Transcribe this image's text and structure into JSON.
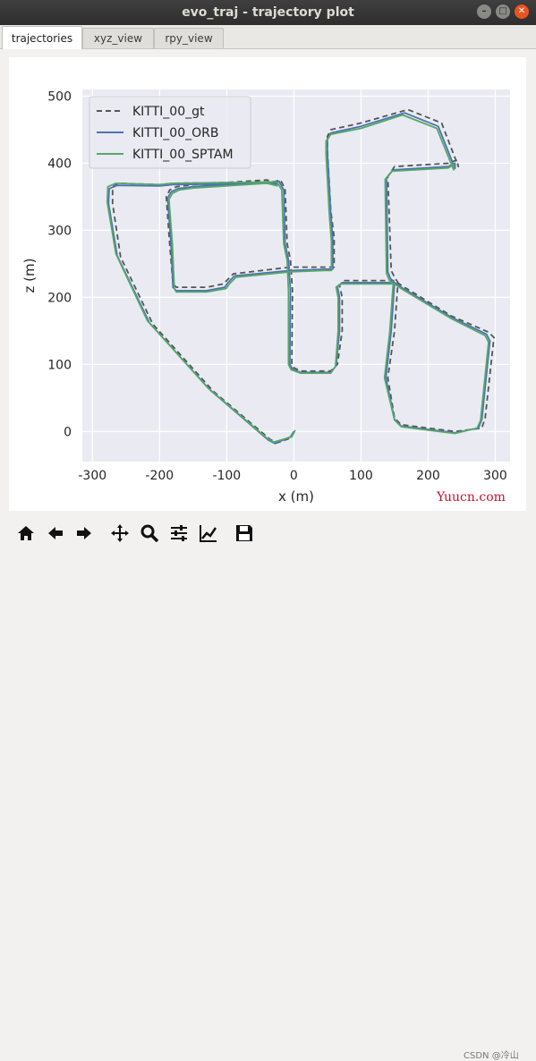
{
  "window": {
    "title": "evo_traj - trajectory plot",
    "buttons": [
      "minimize",
      "maximize",
      "close"
    ]
  },
  "tabs": [
    {
      "label": "trajectories",
      "active": true
    },
    {
      "label": "xyz_view",
      "active": false
    },
    {
      "label": "rpy_view",
      "active": false
    }
  ],
  "chart_data": {
    "type": "line",
    "xlabel": "x (m)",
    "ylabel": "z (m)",
    "xlim": [
      -315,
      322
    ],
    "ylim": [
      -45,
      510
    ],
    "xticks": [
      -300,
      -200,
      -100,
      0,
      100,
      200,
      300
    ],
    "yticks": [
      0,
      100,
      200,
      300,
      400,
      500
    ],
    "grid": true,
    "legend_position": "upper-left",
    "series": [
      {
        "name": "KITTI_00_gt",
        "color": "#555555",
        "dash": "dashed",
        "points": [
          [
            0,
            0
          ],
          [
            -5,
            -10
          ],
          [
            -25,
            -17
          ],
          [
            -35,
            -12
          ],
          [
            -120,
            60
          ],
          [
            -210,
            160
          ],
          [
            -258,
            260
          ],
          [
            -270,
            340
          ],
          [
            -270,
            365
          ],
          [
            -260,
            370
          ],
          [
            -200,
            368
          ],
          [
            -180,
            370
          ],
          [
            -30,
            372
          ],
          [
            -20,
            375
          ],
          [
            -13,
            362
          ],
          [
            -10,
            280
          ],
          [
            -5,
            255
          ],
          [
            -2,
            210
          ],
          [
            -3,
            100
          ],
          [
            0,
            95
          ],
          [
            10,
            90
          ],
          [
            55,
            90
          ],
          [
            65,
            100
          ],
          [
            72,
            150
          ],
          [
            72,
            200
          ],
          [
            68,
            218
          ],
          [
            72,
            222
          ],
          [
            75,
            225
          ],
          [
            150,
            225
          ],
          [
            160,
            218
          ],
          [
            235,
            172
          ],
          [
            290,
            148
          ],
          [
            298,
            140
          ],
          [
            285,
            20
          ],
          [
            280,
            5
          ],
          [
            240,
            0
          ],
          [
            200,
            5
          ],
          [
            160,
            10
          ],
          [
            150,
            20
          ],
          [
            140,
            80
          ],
          [
            150,
            150
          ],
          [
            155,
            222
          ],
          [
            150,
            230
          ],
          [
            145,
            240
          ],
          [
            140,
            380
          ],
          [
            150,
            395
          ],
          [
            230,
            400
          ],
          [
            243,
            405
          ],
          [
            245,
            395
          ],
          [
            220,
            460
          ],
          [
            170,
            480
          ],
          [
            100,
            460
          ],
          [
            55,
            450
          ],
          [
            50,
            440
          ],
          [
            50,
            420
          ],
          [
            55,
            330
          ],
          [
            60,
            290
          ],
          [
            60,
            245
          ],
          [
            50,
            245
          ],
          [
            -5,
            245
          ],
          [
            -90,
            235
          ],
          [
            -100,
            225
          ],
          [
            -105,
            220
          ],
          [
            -130,
            215
          ],
          [
            -175,
            215
          ],
          [
            -180,
            220
          ],
          [
            -185,
            280
          ],
          [
            -190,
            350
          ],
          [
            -185,
            360
          ],
          [
            -175,
            365
          ],
          [
            -150,
            368
          ],
          [
            -40,
            375
          ],
          [
            -20,
            370
          ]
        ]
      },
      {
        "name": "KITTI_00_ORB",
        "color": "#4c72b0",
        "dash": "solid",
        "points": [
          [
            0,
            0
          ],
          [
            -5,
            -8
          ],
          [
            -28,
            -18
          ],
          [
            -38,
            -13
          ],
          [
            -125,
            62
          ],
          [
            -215,
            162
          ],
          [
            -263,
            262
          ],
          [
            -276,
            340
          ],
          [
            -275,
            362
          ],
          [
            -263,
            367
          ],
          [
            -200,
            366
          ],
          [
            -180,
            368
          ],
          [
            -30,
            370
          ],
          [
            -22,
            373
          ],
          [
            -15,
            360
          ],
          [
            -13,
            280
          ],
          [
            -8,
            255
          ],
          [
            -5,
            210
          ],
          [
            -6,
            100
          ],
          [
            -2,
            93
          ],
          [
            10,
            88
          ],
          [
            55,
            88
          ],
          [
            63,
            98
          ],
          [
            68,
            150
          ],
          [
            68,
            200
          ],
          [
            65,
            216
          ],
          [
            70,
            220
          ],
          [
            72,
            222
          ],
          [
            150,
            222
          ],
          [
            160,
            215
          ],
          [
            235,
            170
          ],
          [
            287,
            145
          ],
          [
            292,
            135
          ],
          [
            280,
            18
          ],
          [
            275,
            5
          ],
          [
            240,
            -2
          ],
          [
            200,
            3
          ],
          [
            160,
            8
          ],
          [
            150,
            18
          ],
          [
            137,
            80
          ],
          [
            145,
            150
          ],
          [
            150,
            222
          ],
          [
            144,
            228
          ],
          [
            140,
            238
          ],
          [
            138,
            378
          ],
          [
            148,
            390
          ],
          [
            230,
            395
          ],
          [
            240,
            400
          ],
          [
            240,
            392
          ],
          [
            215,
            455
          ],
          [
            165,
            475
          ],
          [
            100,
            455
          ],
          [
            55,
            445
          ],
          [
            50,
            435
          ],
          [
            50,
            415
          ],
          [
            55,
            325
          ],
          [
            58,
            285
          ],
          [
            58,
            242
          ],
          [
            48,
            242
          ],
          [
            -5,
            240
          ],
          [
            -88,
            232
          ],
          [
            -98,
            222
          ],
          [
            -103,
            215
          ],
          [
            -130,
            210
          ],
          [
            -175,
            210
          ],
          [
            -180,
            215
          ],
          [
            -183,
            280
          ],
          [
            -188,
            348
          ],
          [
            -183,
            357
          ],
          [
            -173,
            362
          ],
          [
            -150,
            365
          ],
          [
            -40,
            372
          ],
          [
            -22,
            368
          ]
        ]
      },
      {
        "name": "KITTI_00_SPTAM",
        "color": "#55a868",
        "dash": "solid",
        "points": [
          [
            2,
            2
          ],
          [
            -3,
            -8
          ],
          [
            -30,
            -16
          ],
          [
            -40,
            -10
          ],
          [
            -128,
            65
          ],
          [
            -218,
            165
          ],
          [
            -265,
            265
          ],
          [
            -278,
            342
          ],
          [
            -277,
            365
          ],
          [
            -265,
            370
          ],
          [
            -200,
            368
          ],
          [
            -180,
            370
          ],
          [
            -30,
            372
          ],
          [
            -25,
            372
          ],
          [
            -18,
            360
          ],
          [
            -15,
            280
          ],
          [
            -10,
            255
          ],
          [
            -8,
            210
          ],
          [
            -8,
            100
          ],
          [
            -4,
            92
          ],
          [
            10,
            87
          ],
          [
            55,
            87
          ],
          [
            62,
            97
          ],
          [
            66,
            150
          ],
          [
            66,
            200
          ],
          [
            63,
            215
          ],
          [
            68,
            219
          ],
          [
            70,
            220
          ],
          [
            150,
            220
          ],
          [
            160,
            213
          ],
          [
            235,
            168
          ],
          [
            285,
            143
          ],
          [
            290,
            133
          ],
          [
            278,
            16
          ],
          [
            273,
            5
          ],
          [
            240,
            -3
          ],
          [
            200,
            2
          ],
          [
            160,
            7
          ],
          [
            150,
            17
          ],
          [
            135,
            80
          ],
          [
            143,
            150
          ],
          [
            148,
            220
          ],
          [
            142,
            226
          ],
          [
            138,
            236
          ],
          [
            136,
            376
          ],
          [
            146,
            388
          ],
          [
            230,
            393
          ],
          [
            238,
            398
          ],
          [
            238,
            390
          ],
          [
            213,
            452
          ],
          [
            162,
            472
          ],
          [
            100,
            452
          ],
          [
            55,
            443
          ],
          [
            48,
            433
          ],
          [
            48,
            413
          ],
          [
            53,
            323
          ],
          [
            56,
            283
          ],
          [
            56,
            240
          ],
          [
            46,
            240
          ],
          [
            -5,
            238
          ],
          [
            -86,
            230
          ],
          [
            -96,
            220
          ],
          [
            -101,
            213
          ],
          [
            -130,
            208
          ],
          [
            -175,
            208
          ],
          [
            -178,
            213
          ],
          [
            -181,
            280
          ],
          [
            -186,
            346
          ],
          [
            -181,
            355
          ],
          [
            -171,
            360
          ],
          [
            -150,
            363
          ],
          [
            -40,
            370
          ],
          [
            -24,
            366
          ]
        ]
      }
    ]
  },
  "toolbar": {
    "icons": [
      "home-icon",
      "back-arrow-icon",
      "forward-arrow-icon",
      "pan-move-icon",
      "zoom-magnifier-icon",
      "configure-subplots-icon",
      "edit-axis-curve-icon",
      "save-floppy-icon"
    ]
  },
  "watermark": "Yuucn.com",
  "credit": "CSDN @冷山"
}
